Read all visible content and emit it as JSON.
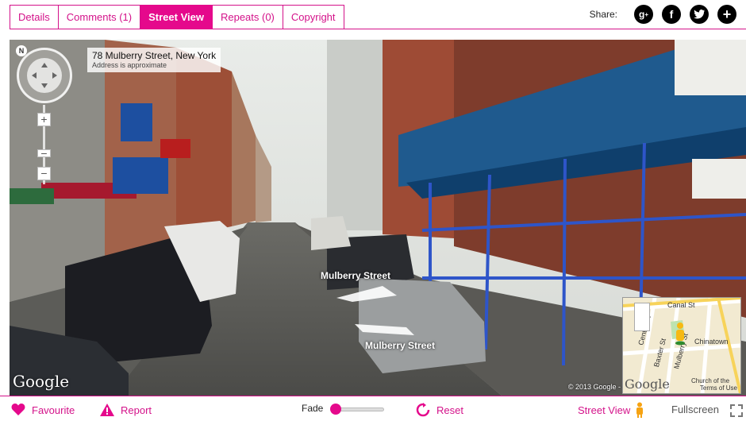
{
  "tabs": [
    {
      "label": "Details"
    },
    {
      "label": "Comments (1)"
    },
    {
      "label": "Street View"
    },
    {
      "label": "Repeats (0)"
    },
    {
      "label": "Copyright"
    }
  ],
  "share": {
    "label": "Share:",
    "icons": [
      "google-plus-icon",
      "facebook-icon",
      "twitter-icon",
      "plus-icon"
    ]
  },
  "streetview": {
    "address": "78 Mulberry Street, New York",
    "address_note": "Address is approximate",
    "compass_n": "N",
    "zoom_in": "+",
    "zoom_out": "−",
    "street_label_1": "Mulberry Street",
    "street_label_2": "Mulberry Street",
    "google_logo": "Google",
    "copyright": "© 2013 Google -",
    "minimap": {
      "labels": [
        "Canal St",
        "Chinatown",
        "Centre St",
        "Baxter St",
        "Mulberry St",
        "Church of the"
      ],
      "google_logo": "Google",
      "terms": "Terms of Use"
    }
  },
  "bottom": {
    "favourite": "Favourite",
    "report": "Report",
    "fade_label": "Fade",
    "fade_value": 0,
    "reset": "Reset",
    "street_view": "Street View",
    "fullscreen": "Fullscreen"
  },
  "colors": {
    "accent": "#e5098c"
  }
}
